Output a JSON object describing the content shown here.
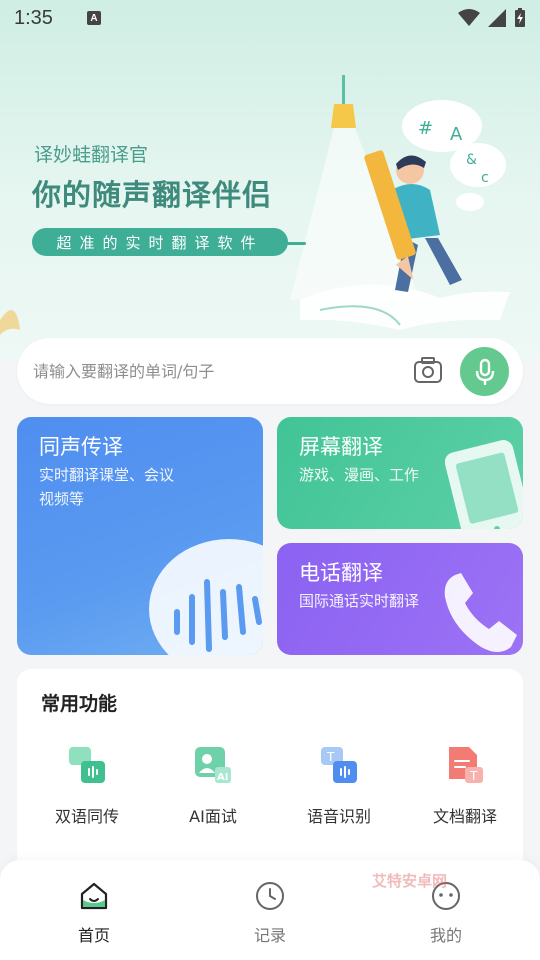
{
  "status_bar": {
    "time": "1:35",
    "badge": "A"
  },
  "banner": {
    "brand": "译妙蛙翻译官",
    "headline": "你的随声翻译伴侣",
    "tagline": "超准的实时翻译软件"
  },
  "search": {
    "placeholder": "请输入要翻译的单词/句子"
  },
  "cards": {
    "simultaneous": {
      "title": "同声传译",
      "desc_line1": "实时翻译课堂、会议",
      "desc_line2": "视频等"
    },
    "screen": {
      "title": "屏幕翻译",
      "desc": "游戏、漫画、工作"
    },
    "phone": {
      "title": "电话翻译",
      "desc": "国际通话实时翻译"
    }
  },
  "common": {
    "heading": "常用功能",
    "items": [
      {
        "label": "双语同传",
        "icon": "bilingual-icon"
      },
      {
        "label": "AI面试",
        "icon": "ai-interview-icon"
      },
      {
        "label": "语音识别",
        "icon": "voice-recognition-icon"
      },
      {
        "label": "文档翻译",
        "icon": "document-translate-icon"
      }
    ]
  },
  "nav": {
    "items": [
      {
        "label": "首页",
        "active": true
      },
      {
        "label": "记录",
        "active": false
      },
      {
        "label": "我的",
        "active": false
      }
    ]
  },
  "watermark": "艾特安卓网",
  "colors": {
    "accent_green": "#3fae97",
    "mic_green": "#64c98e",
    "card_blue": "#4f8ef0",
    "card_green": "#41c497",
    "card_purple": "#8b62f2"
  }
}
